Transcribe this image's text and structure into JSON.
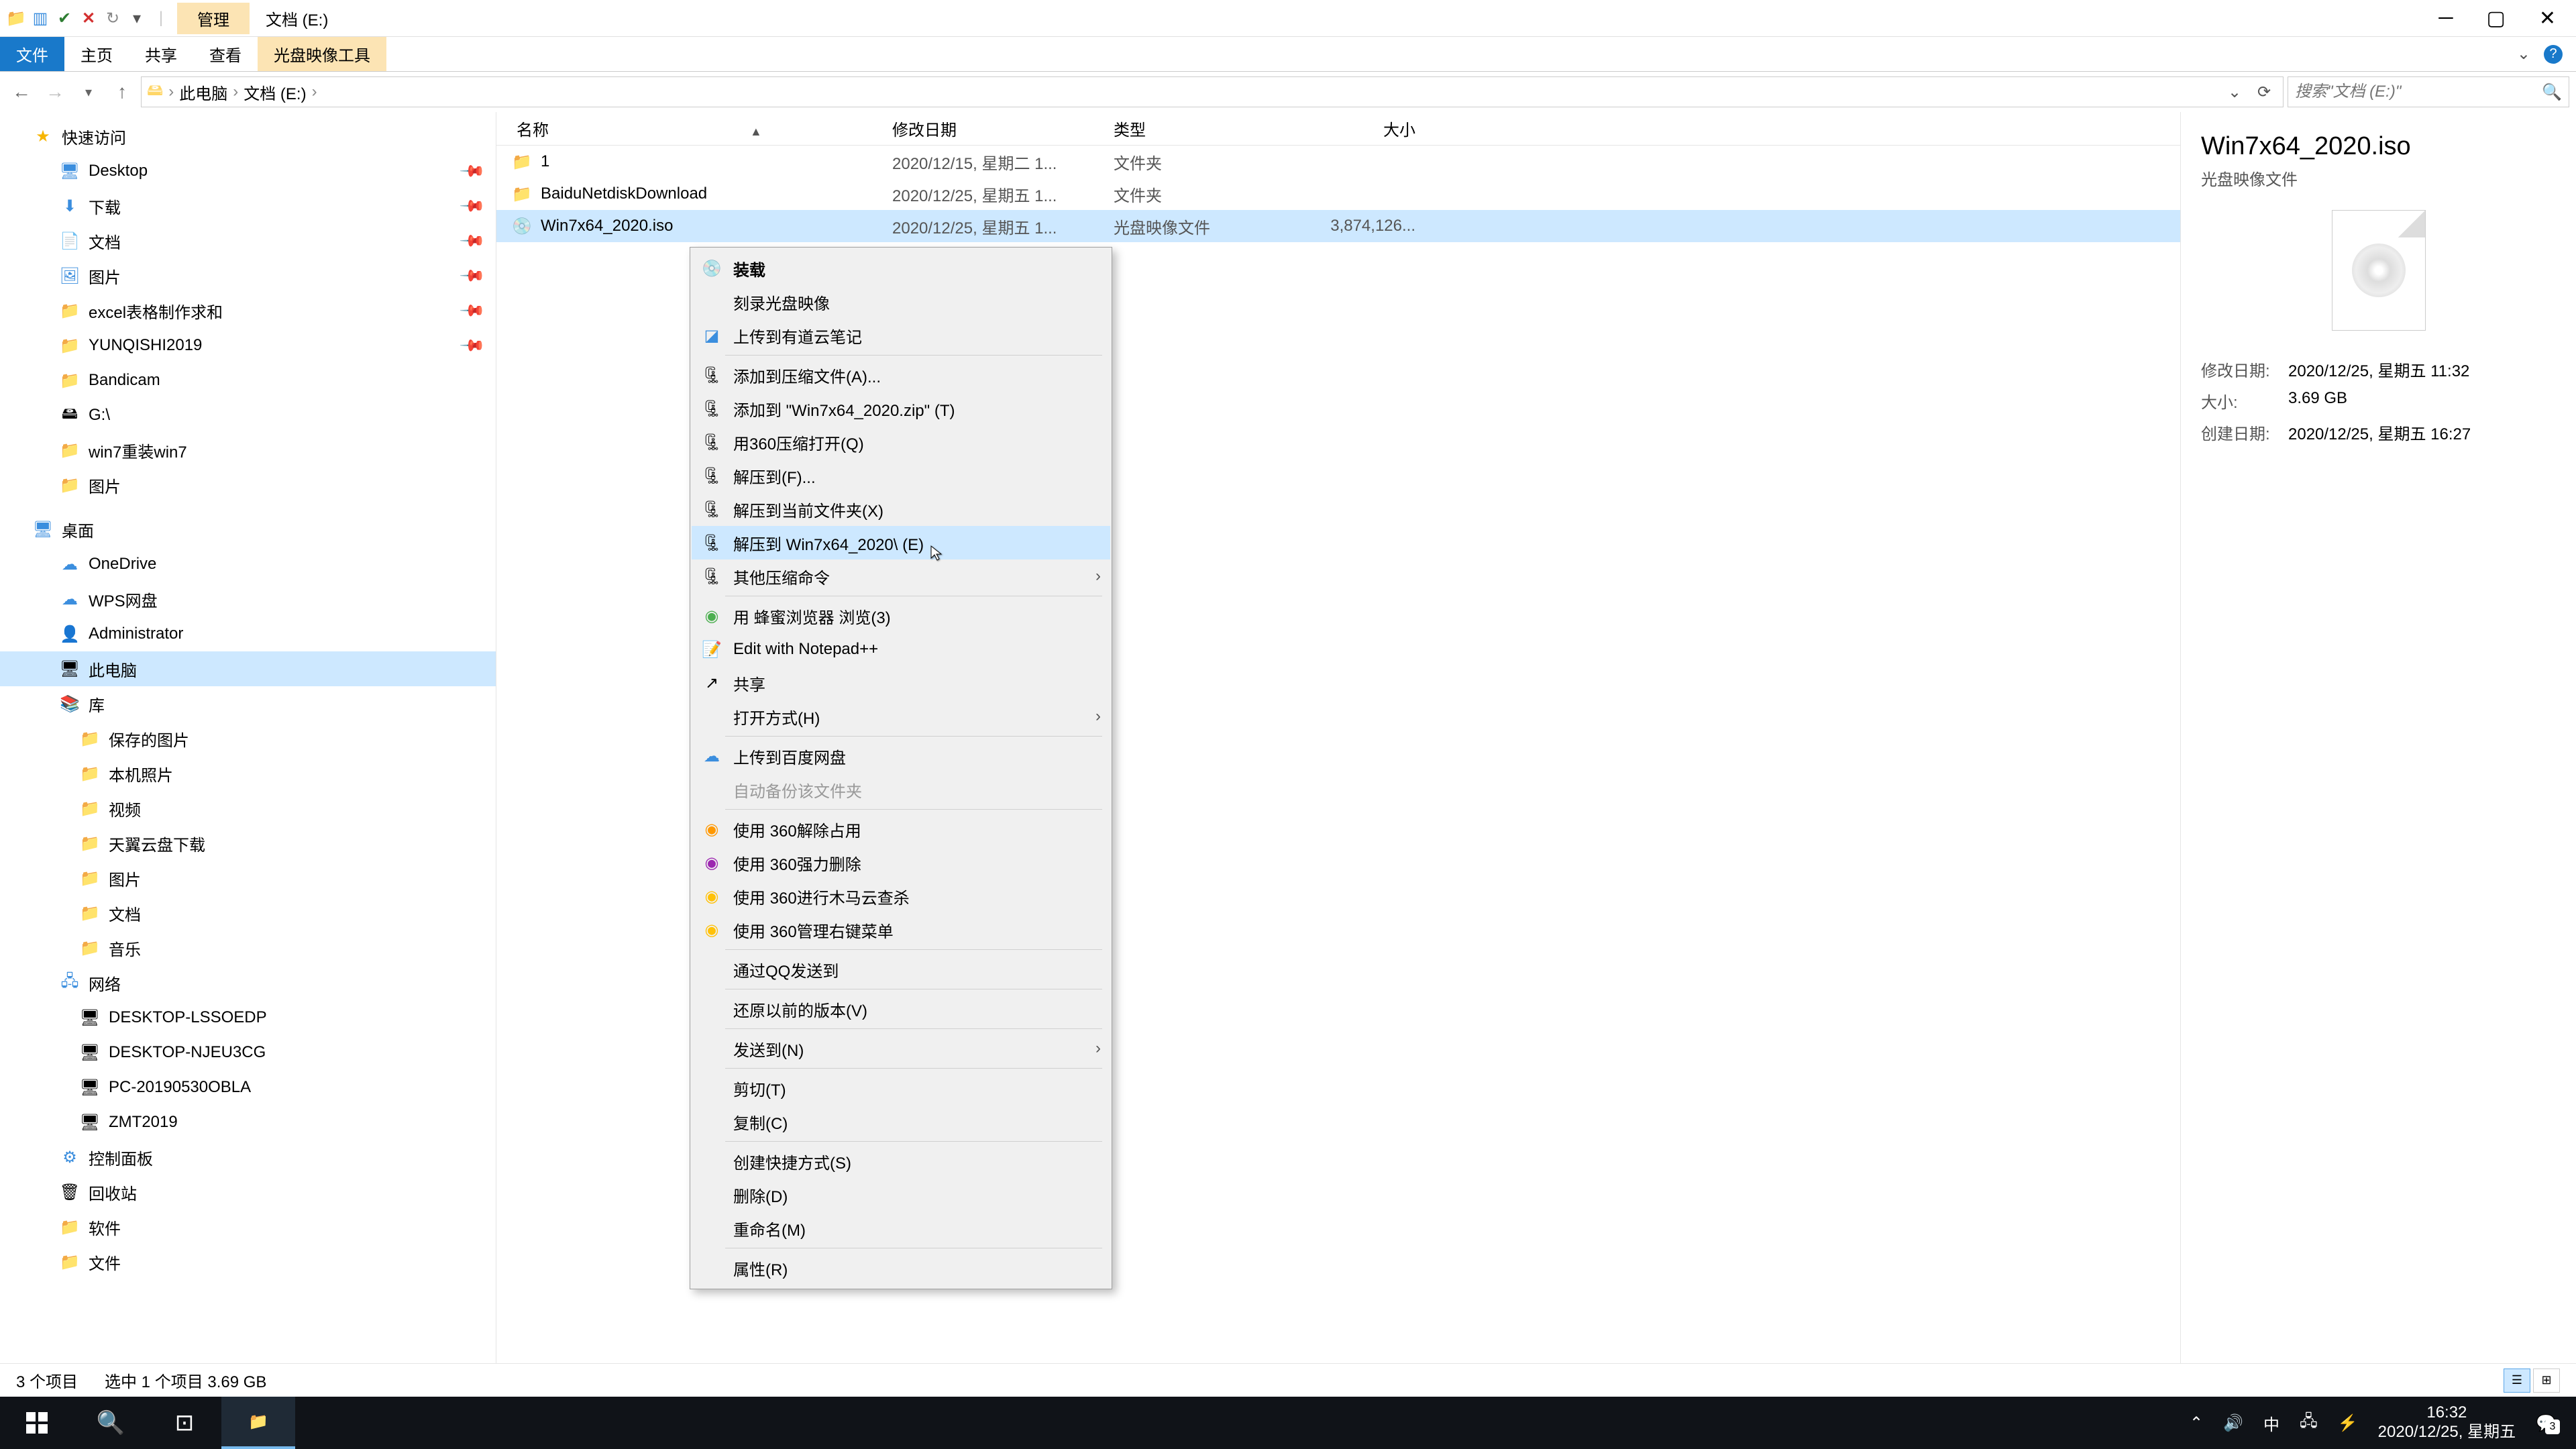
{
  "window": {
    "context_tab": "管理",
    "title": "文档 (E:)",
    "ribbon": {
      "file": "文件",
      "home": "主页",
      "share": "共享",
      "view": "查看",
      "disc_tools": "光盘映像工具"
    }
  },
  "breadcrumb": {
    "pc": "此电脑",
    "drive": "文档 (E:)"
  },
  "search": {
    "placeholder": "搜索\"文档 (E:)\""
  },
  "nav": {
    "quick_access": "快速访问",
    "desktop": "Desktop",
    "downloads": "下载",
    "documents": "文档",
    "pictures": "图片",
    "excel": "excel表格制作求和",
    "yunqishi": "YUNQISHI2019",
    "bandicam": "Bandicam",
    "g_drive": "G:\\",
    "win7reload": "win7重装win7",
    "pictures2": "图片",
    "desktop_zh": "桌面",
    "onedrive": "OneDrive",
    "wps": "WPS网盘",
    "admin": "Administrator",
    "this_pc": "此电脑",
    "libraries": "库",
    "saved_pics": "保存的图片",
    "local_pics": "本机照片",
    "videos": "视频",
    "tianyun": "天翼云盘下载",
    "pics3": "图片",
    "docs3": "文档",
    "music": "音乐",
    "network": "网络",
    "pc1": "DESKTOP-LSSOEDP",
    "pc2": "DESKTOP-NJEU3CG",
    "pc3": "PC-20190530OBLA",
    "pc4": "ZMT2019",
    "ctrl_panel": "控制面板",
    "recycle": "回收站",
    "software": "软件",
    "files": "文件"
  },
  "columns": {
    "name": "名称",
    "date": "修改日期",
    "type": "类型",
    "size": "大小"
  },
  "files": [
    {
      "name": "1",
      "date": "2020/12/15, 星期二 1...",
      "type": "文件夹",
      "size": ""
    },
    {
      "name": "BaiduNetdiskDownload",
      "date": "2020/12/25, 星期五 1...",
      "type": "文件夹",
      "size": ""
    },
    {
      "name": "Win7x64_2020.iso",
      "date": "2020/12/25, 星期五 1...",
      "type": "光盘映像文件",
      "size": "3,874,126..."
    }
  ],
  "context_menu": {
    "mount": "装载",
    "burn": "刻录光盘映像",
    "youdao": "上传到有道云笔记",
    "add_archive": "添加到压缩文件(A)...",
    "add_zip": "添加到 \"Win7x64_2020.zip\" (T)",
    "open_360": "用360压缩打开(Q)",
    "extract_to": "解压到(F)...",
    "extract_here": "解压到当前文件夹(X)",
    "extract_named": "解压到 Win7x64_2020\\ (E)",
    "other_compress": "其他压缩命令",
    "honey_browser": "用 蜂蜜浏览器 浏览(3)",
    "notepad": "Edit with Notepad++",
    "share": "共享",
    "open_with": "打开方式(H)",
    "baidu_upload": "上传到百度网盘",
    "auto_backup": "自动备份该文件夹",
    "unlock_360": "使用 360解除占用",
    "force_del_360": "使用 360强力删除",
    "trojan_360": "使用 360进行木马云查杀",
    "manage_360": "使用 360管理右键菜单",
    "qq_send": "通过QQ发送到",
    "restore": "还原以前的版本(V)",
    "send_to": "发送到(N)",
    "cut": "剪切(T)",
    "copy": "复制(C)",
    "shortcut": "创建快捷方式(S)",
    "delete": "删除(D)",
    "rename": "重命名(M)",
    "properties": "属性(R)"
  },
  "preview": {
    "title": "Win7x64_2020.iso",
    "subtitle": "光盘映像文件",
    "mod_label": "修改日期:",
    "mod_val": "2020/12/25, 星期五 11:32",
    "size_label": "大小:",
    "size_val": "3.69 GB",
    "created_label": "创建日期:",
    "created_val": "2020/12/25, 星期五 16:27"
  },
  "status": {
    "count": "3 个项目",
    "selection": "选中 1 个项目  3.69 GB"
  },
  "taskbar": {
    "time": "16:32",
    "date": "2020/12/25, 星期五",
    "ime": "中"
  }
}
